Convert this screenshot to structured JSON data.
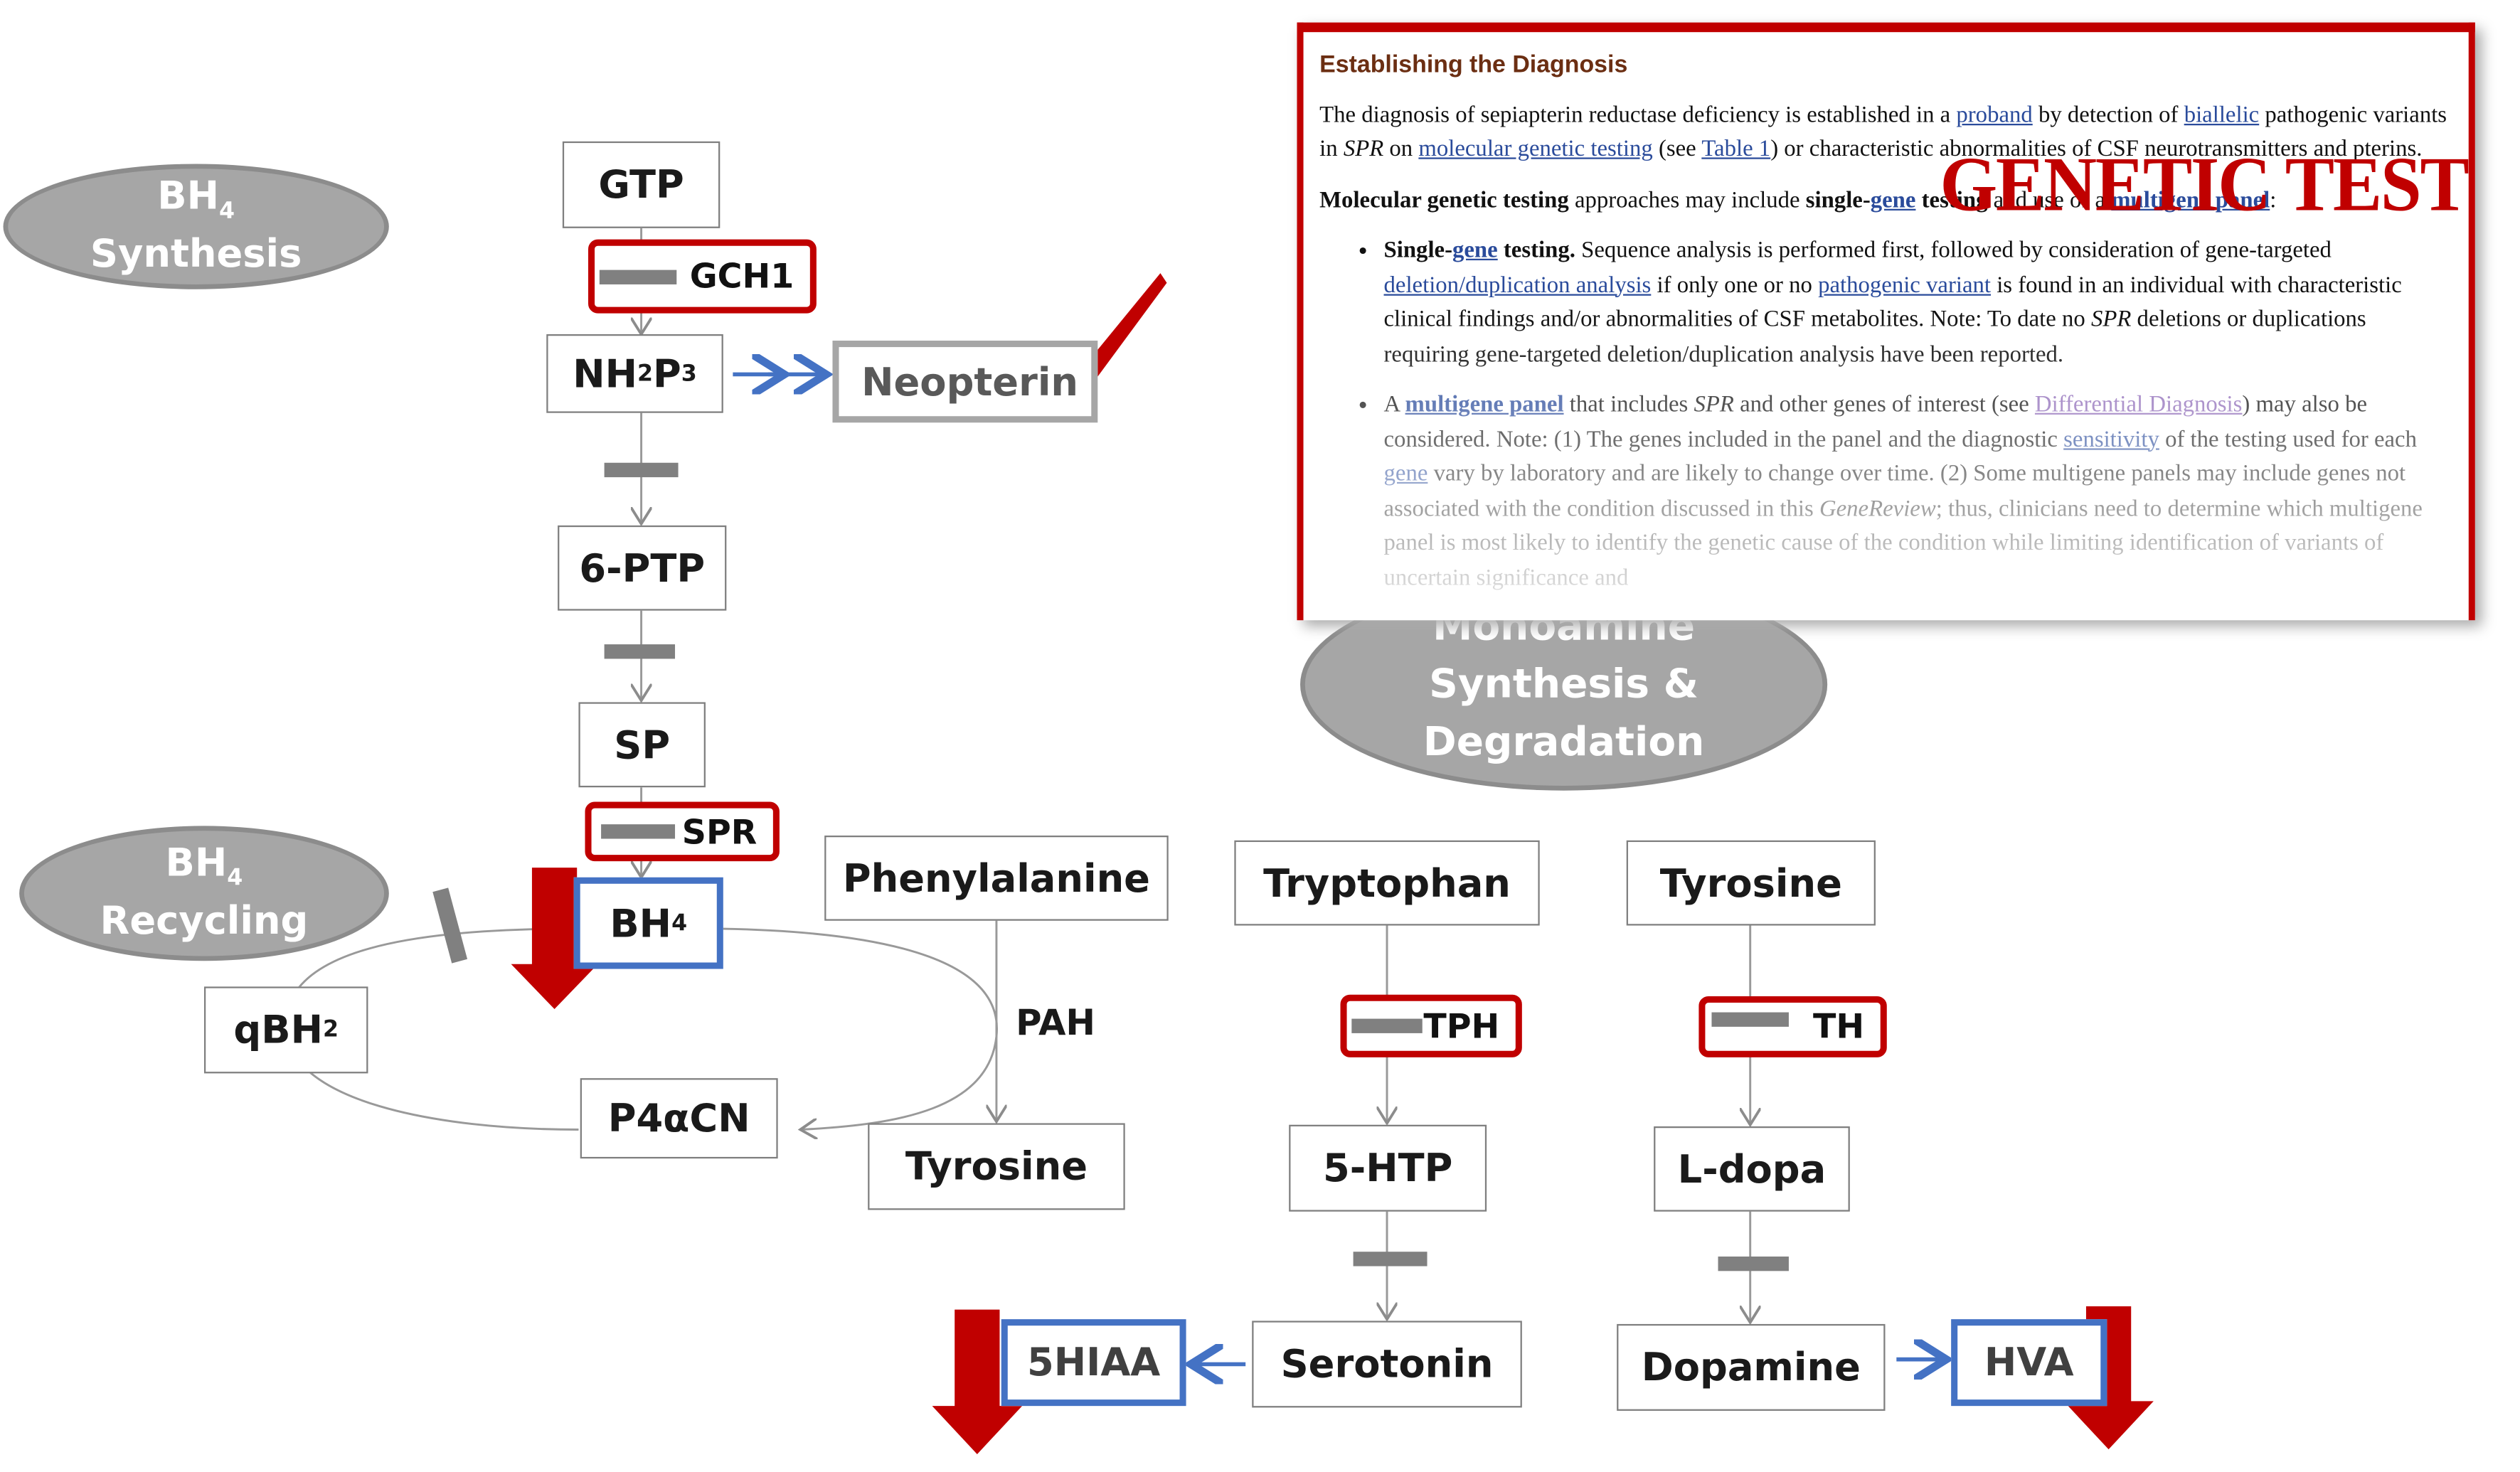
{
  "diagram": {
    "bh4_synthesis": {
      "line1": "BH",
      "sub": "4",
      "line2": "Synthesis"
    },
    "bh4_recycling": {
      "line1": "BH",
      "sub": "4",
      "line2": "Recycling"
    },
    "monoamine": {
      "line1": "Monoamine",
      "line2": "Synthesis &",
      "line3": "Degradation"
    },
    "gtp": "GTP",
    "gch1": "GCH1",
    "nh2p3": {
      "a": "NH",
      "s1": "2",
      "b": "P",
      "s2": "3"
    },
    "neopterin": "Neopterin",
    "ptp": "6-PTP",
    "sp": "SP",
    "spr": "SPR",
    "bh4": {
      "a": "BH",
      "s": "4"
    },
    "qbh2": {
      "a": "qBH",
      "s": "2"
    },
    "p4acn": "P4αCN",
    "phenylalanine": "Phenylalanine",
    "pah": "PAH",
    "tyrosine_left": "Tyrosine",
    "tryptophan": "Tryptophan",
    "tph": "TPH",
    "htp": "5-HTP",
    "serotonin": "Serotonin",
    "hiaa": "5HIAA",
    "tyrosine_right": "Tyrosine",
    "th": "TH",
    "ldopa": "L-dopa",
    "dopamine": "Dopamine",
    "hva": "HVA",
    "colors": {
      "enzyme_border": "#c00000",
      "metabolite_border": "#4472c4",
      "decrease_arrow": "#c00000",
      "ellipse": "#a6a6a6"
    }
  },
  "document": {
    "heading": "Establishing the Diagnosis",
    "stamp": "GENETIC TEST",
    "p1": [
      "The diagnosis of sepiapterin reductase deficiency is established in a ",
      "proband",
      " by detection of ",
      "biallelic",
      " pathogenic variants in ",
      "SPR",
      " on ",
      "molecular genetic testing",
      " (see ",
      "Table 1",
      ") or characteristic abnormalities of CSF neurotransmitters and pterins."
    ],
    "p2": [
      "Molecular genetic testing",
      " approaches may include ",
      "single-",
      "gene",
      " testing",
      " and use of a ",
      "multigene panel",
      ":"
    ],
    "b1": [
      "Single-",
      "gene",
      " testing.",
      " Sequence analysis is performed first, followed by consideration of gene-targeted ",
      "deletion/duplication analysis",
      " if only one or no ",
      "pathogenic variant",
      " is found in an individual with characteristic clinical findings and/or abnormalities of CSF metabolites. Note: To date no ",
      "SPR",
      " deletions or duplications requiring gene-targeted deletion/duplication analysis have been reported."
    ],
    "b2": [
      "A ",
      "multigene panel",
      " that includes ",
      "SPR",
      " and other genes of interest (see ",
      "Differential Diagnosis",
      ") may also be considered. Note: (1) The genes included in the panel and the diagnostic ",
      "sensitivity",
      " of the testing used for each ",
      "gene",
      " vary by laboratory and are likely to change over time. (2) Some multigene panels may include genes not associated with the condition discussed in this ",
      "GeneReview",
      "; thus, clinicians need to determine which multigene panel is most likely to identify the genetic cause of the condition while limiting identification of variants of uncertain significance and"
    ]
  }
}
